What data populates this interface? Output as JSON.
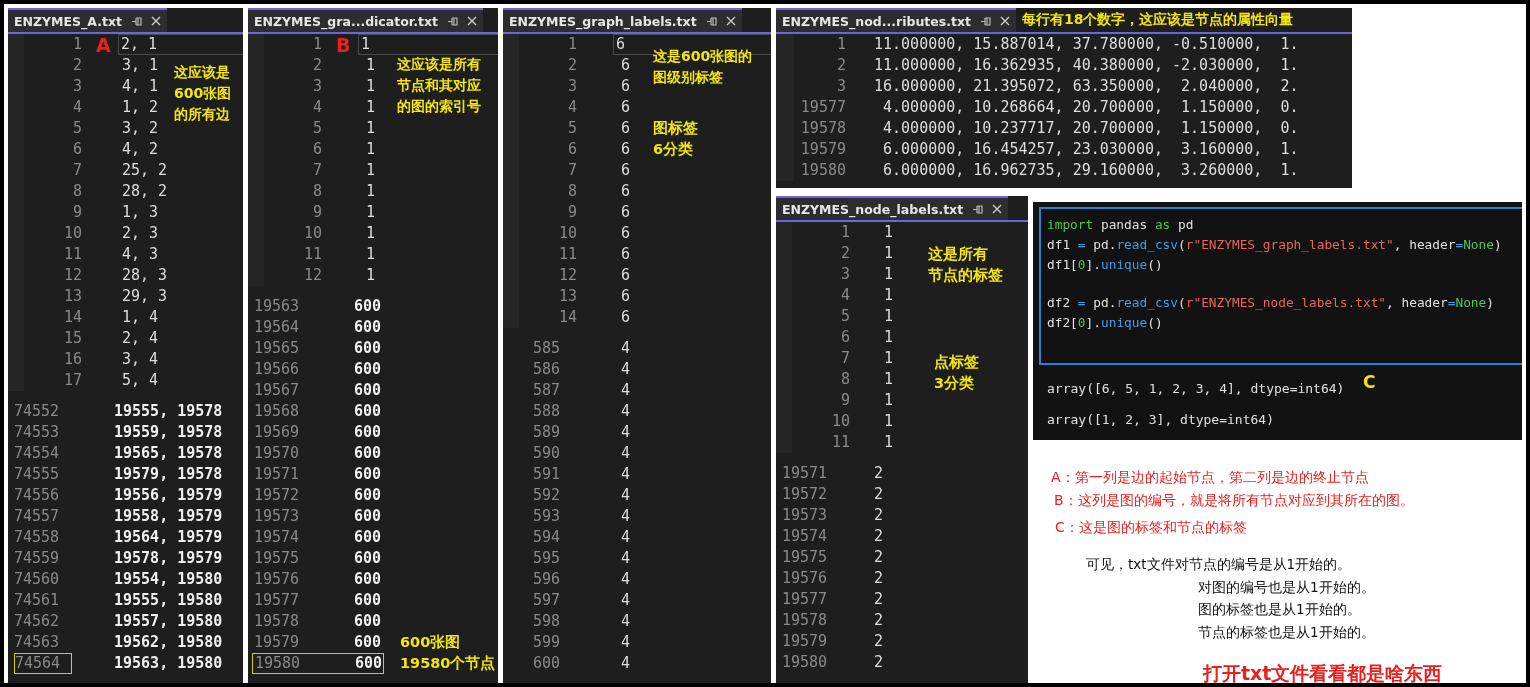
{
  "files": [
    {
      "tab": "ENZYMES_A.txt",
      "marker": "A",
      "notes": [
        [
          "这应该是",
          "600张图",
          "的所有边"
        ]
      ],
      "segments": [
        {
          "lines": [
            {
              "n": "1",
              "t": "2, 1",
              "current": true
            },
            {
              "n": "2",
              "t": "3, 1"
            },
            {
              "n": "3",
              "t": "4, 1"
            },
            {
              "n": "4",
              "t": "1, 2"
            },
            {
              "n": "5",
              "t": "3, 2"
            },
            {
              "n": "6",
              "t": "4, 2"
            },
            {
              "n": "7",
              "t": "25, 2"
            },
            {
              "n": "8",
              "t": "28, 2"
            },
            {
              "n": "9",
              "t": "1, 3"
            },
            {
              "n": "10",
              "t": "2, 3"
            },
            {
              "n": "11",
              "t": "4, 3"
            },
            {
              "n": "12",
              "t": "28, 3"
            },
            {
              "n": "13",
              "t": "29, 3"
            },
            {
              "n": "14",
              "t": "1, 4"
            },
            {
              "n": "15",
              "t": "2, 4"
            },
            {
              "n": "16",
              "t": "3, 4"
            },
            {
              "n": "17",
              "t": "5, 4"
            }
          ]
        },
        {
          "lines": [
            {
              "n": "74552",
              "t": "19555, 19578"
            },
            {
              "n": "74553",
              "t": "19559, 19578"
            },
            {
              "n": "74554",
              "t": "19565, 19578"
            },
            {
              "n": "74555",
              "t": "19579, 19578"
            },
            {
              "n": "74556",
              "t": "19556, 19579"
            },
            {
              "n": "74557",
              "t": "19558, 19579"
            },
            {
              "n": "74558",
              "t": "19564, 19579"
            },
            {
              "n": "74559",
              "t": "19578, 19579"
            },
            {
              "n": "74560",
              "t": "19554, 19580"
            },
            {
              "n": "74561",
              "t": "19555, 19580"
            },
            {
              "n": "74562",
              "t": "19557, 19580"
            },
            {
              "n": "74563",
              "t": "19562, 19580"
            },
            {
              "n": "74564",
              "t": "19563, 19580",
              "boxed_number": true
            }
          ]
        }
      ]
    },
    {
      "tab": "ENZYMES_gra...dicator.txt",
      "marker": "B",
      "notes": [
        [
          "这应该是所有",
          "节点和其对应",
          "的图的索引号"
        ],
        [
          "600张图",
          "19580个节点"
        ]
      ],
      "segments": [
        {
          "lines": [
            {
              "n": "1",
              "t": "1",
              "current": true
            },
            {
              "n": "2",
              "t": "1"
            },
            {
              "n": "3",
              "t": "1"
            },
            {
              "n": "4",
              "t": "1"
            },
            {
              "n": "5",
              "t": "1"
            },
            {
              "n": "6",
              "t": "1"
            },
            {
              "n": "7",
              "t": "1"
            },
            {
              "n": "8",
              "t": "1"
            },
            {
              "n": "9",
              "t": "1"
            },
            {
              "n": "10",
              "t": "1"
            },
            {
              "n": "11",
              "t": "1"
            },
            {
              "n": "12",
              "t": "1"
            }
          ]
        },
        {
          "lines": [
            {
              "n": "19563",
              "t": "600"
            },
            {
              "n": "19564",
              "t": "600"
            },
            {
              "n": "19565",
              "t": "600"
            },
            {
              "n": "19566",
              "t": "600"
            },
            {
              "n": "19567",
              "t": "600"
            },
            {
              "n": "19568",
              "t": "600"
            },
            {
              "n": "19569",
              "t": "600"
            },
            {
              "n": "19570",
              "t": "600"
            },
            {
              "n": "19571",
              "t": "600"
            },
            {
              "n": "19572",
              "t": "600"
            },
            {
              "n": "19573",
              "t": "600"
            },
            {
              "n": "19574",
              "t": "600"
            },
            {
              "n": "19575",
              "t": "600"
            },
            {
              "n": "19576",
              "t": "600"
            },
            {
              "n": "19577",
              "t": "600"
            },
            {
              "n": "19578",
              "t": "600"
            },
            {
              "n": "19579",
              "t": "600"
            },
            {
              "n": "19580",
              "t": "600",
              "boxed_row": true
            }
          ]
        }
      ]
    },
    {
      "tab": "ENZYMES_graph_labels.txt",
      "notes": [
        [
          "这是600张图的",
          "图级别标签"
        ],
        [
          "图标签",
          "6分类"
        ]
      ],
      "segments": [
        {
          "lines": [
            {
              "n": "1",
              "t": "6",
              "current": true
            },
            {
              "n": "2",
              "t": "6"
            },
            {
              "n": "3",
              "t": "6"
            },
            {
              "n": "4",
              "t": "6"
            },
            {
              "n": "5",
              "t": "6"
            },
            {
              "n": "6",
              "t": "6"
            },
            {
              "n": "7",
              "t": "6"
            },
            {
              "n": "8",
              "t": "6"
            },
            {
              "n": "9",
              "t": "6"
            },
            {
              "n": "10",
              "t": "6"
            },
            {
              "n": "11",
              "t": "6"
            },
            {
              "n": "12",
              "t": "6"
            },
            {
              "n": "13",
              "t": "6"
            },
            {
              "n": "14",
              "t": "6"
            }
          ]
        },
        {
          "lines": [
            {
              "n": "585",
              "t": "4"
            },
            {
              "n": "586",
              "t": "4"
            },
            {
              "n": "587",
              "t": "4"
            },
            {
              "n": "588",
              "t": "4"
            },
            {
              "n": "589",
              "t": "4"
            },
            {
              "n": "590",
              "t": "4"
            },
            {
              "n": "591",
              "t": "4"
            },
            {
              "n": "592",
              "t": "4"
            },
            {
              "n": "593",
              "t": "4"
            },
            {
              "n": "594",
              "t": "4"
            },
            {
              "n": "595",
              "t": "4"
            },
            {
              "n": "596",
              "t": "4"
            },
            {
              "n": "597",
              "t": "4"
            },
            {
              "n": "598",
              "t": "4"
            },
            {
              "n": "599",
              "t": "4"
            },
            {
              "n": "600",
              "t": "4"
            }
          ]
        }
      ]
    },
    {
      "tab": "ENZYMES_nod...ributes.txt",
      "header_note": "每行有18个数字，这应该是节点的属性向量",
      "segments": [
        {
          "lines": [
            {
              "n": "1",
              "t": "11.000000, 15.887014, 37.780000, -0.510000,  1."
            },
            {
              "n": "2",
              "t": "11.000000, 16.362935, 40.380000, -2.030000,  1."
            },
            {
              "n": "3",
              "t": "16.000000, 21.395072, 63.350000,  2.040000,  2."
            },
            {
              "n": "19577",
              "t": " 4.000000, 10.268664, 20.700000,  1.150000,  0."
            },
            {
              "n": "19578",
              "t": " 4.000000, 10.237717, 20.700000,  1.150000,  0."
            },
            {
              "n": "19579",
              "t": " 6.000000, 16.454257, 23.030000,  3.160000,  1."
            },
            {
              "n": "19580",
              "t": " 6.000000, 16.962735, 29.160000,  3.260000,  1."
            }
          ]
        }
      ]
    },
    {
      "tab": "ENZYMES_node_labels.txt",
      "notes": [
        [
          "这是所有",
          "节点的标签"
        ],
        [
          "点标签",
          "3分类"
        ]
      ],
      "segments": [
        {
          "lines": [
            {
              "n": "1",
              "t": "1"
            },
            {
              "n": "2",
              "t": "1"
            },
            {
              "n": "3",
              "t": "1"
            },
            {
              "n": "4",
              "t": "1"
            },
            {
              "n": "5",
              "t": "1"
            },
            {
              "n": "6",
              "t": "1"
            },
            {
              "n": "7",
              "t": "1"
            },
            {
              "n": "8",
              "t": "1"
            },
            {
              "n": "9",
              "t": "1"
            },
            {
              "n": "10",
              "t": "1"
            },
            {
              "n": "11",
              "t": "1"
            }
          ]
        },
        {
          "lines": [
            {
              "n": "19571",
              "t": "2"
            },
            {
              "n": "19572",
              "t": "2"
            },
            {
              "n": "19573",
              "t": "2"
            },
            {
              "n": "19574",
              "t": "2"
            },
            {
              "n": "19575",
              "t": "2"
            },
            {
              "n": "19576",
              "t": "2"
            },
            {
              "n": "19577",
              "t": "2"
            },
            {
              "n": "19578",
              "t": "2"
            },
            {
              "n": "19579",
              "t": "2"
            },
            {
              "n": "19580",
              "t": "2"
            }
          ]
        }
      ]
    }
  ],
  "notebook": {
    "code_groups": [
      [
        [
          {
            "t": "import",
            "kind": "keyword"
          },
          {
            "t": " pandas ",
            "kind": "plain"
          },
          {
            "t": "as",
            "kind": "keyword"
          },
          {
            "t": " pd",
            "kind": "plain"
          }
        ],
        [
          {
            "t": "df1 ",
            "kind": "plain"
          },
          {
            "t": "=",
            "kind": "operator"
          },
          {
            "t": " pd.",
            "kind": "plain"
          },
          {
            "t": "read_csv",
            "kind": "function"
          },
          {
            "t": "(",
            "kind": "plain"
          },
          {
            "t": "r\"ENZYMES_graph_labels.txt\"",
            "kind": "string"
          },
          {
            "t": ", header",
            "kind": "plain"
          },
          {
            "t": "=",
            "kind": "operator"
          },
          {
            "t": "None",
            "kind": "constant"
          },
          {
            "t": ")",
            "kind": "plain"
          }
        ],
        [
          {
            "t": "df1[",
            "kind": "plain"
          },
          {
            "t": "0",
            "kind": "number"
          },
          {
            "t": "].",
            "kind": "plain"
          },
          {
            "t": "unique",
            "kind": "function"
          },
          {
            "t": "()",
            "kind": "plain"
          }
        ]
      ],
      [
        [
          {
            "t": "df2 ",
            "kind": "plain"
          },
          {
            "t": "=",
            "kind": "operator"
          },
          {
            "t": " pd.",
            "kind": "plain"
          },
          {
            "t": "read_csv",
            "kind": "function"
          },
          {
            "t": "(",
            "kind": "plain"
          },
          {
            "t": "r\"ENZYMES_node_labels.txt\"",
            "kind": "string"
          },
          {
            "t": ", header",
            "kind": "plain"
          },
          {
            "t": "=",
            "kind": "operator"
          },
          {
            "t": "None",
            "kind": "constant"
          },
          {
            "t": ")",
            "kind": "plain"
          }
        ],
        [
          {
            "t": "df2[",
            "kind": "plain"
          },
          {
            "t": "0",
            "kind": "number"
          },
          {
            "t": "].",
            "kind": "plain"
          },
          {
            "t": "unique",
            "kind": "function"
          },
          {
            "t": "()",
            "kind": "plain"
          }
        ]
      ]
    ],
    "outputs": [
      "array([6, 5, 1, 2, 3, 4], dtype=int64)",
      "array([1, 2, 3], dtype=int64)"
    ],
    "marker": "C"
  },
  "explanations": [
    "A：第一列是边的起始节点，第二列是边的终止节点",
    "B：这列是图的编号，就是将所有节点对应到其所在的图。",
    "C：这是图的标签和节点的标签"
  ],
  "conclusion": [
    "可见，txt文件对节点的编号是从1开始的。",
    "对图的编号也是从1开始的。",
    "图的标签也是从1开始的。",
    "节点的标签也是从1开始的。"
  ],
  "title": "打开txt文件看看都是啥东西"
}
